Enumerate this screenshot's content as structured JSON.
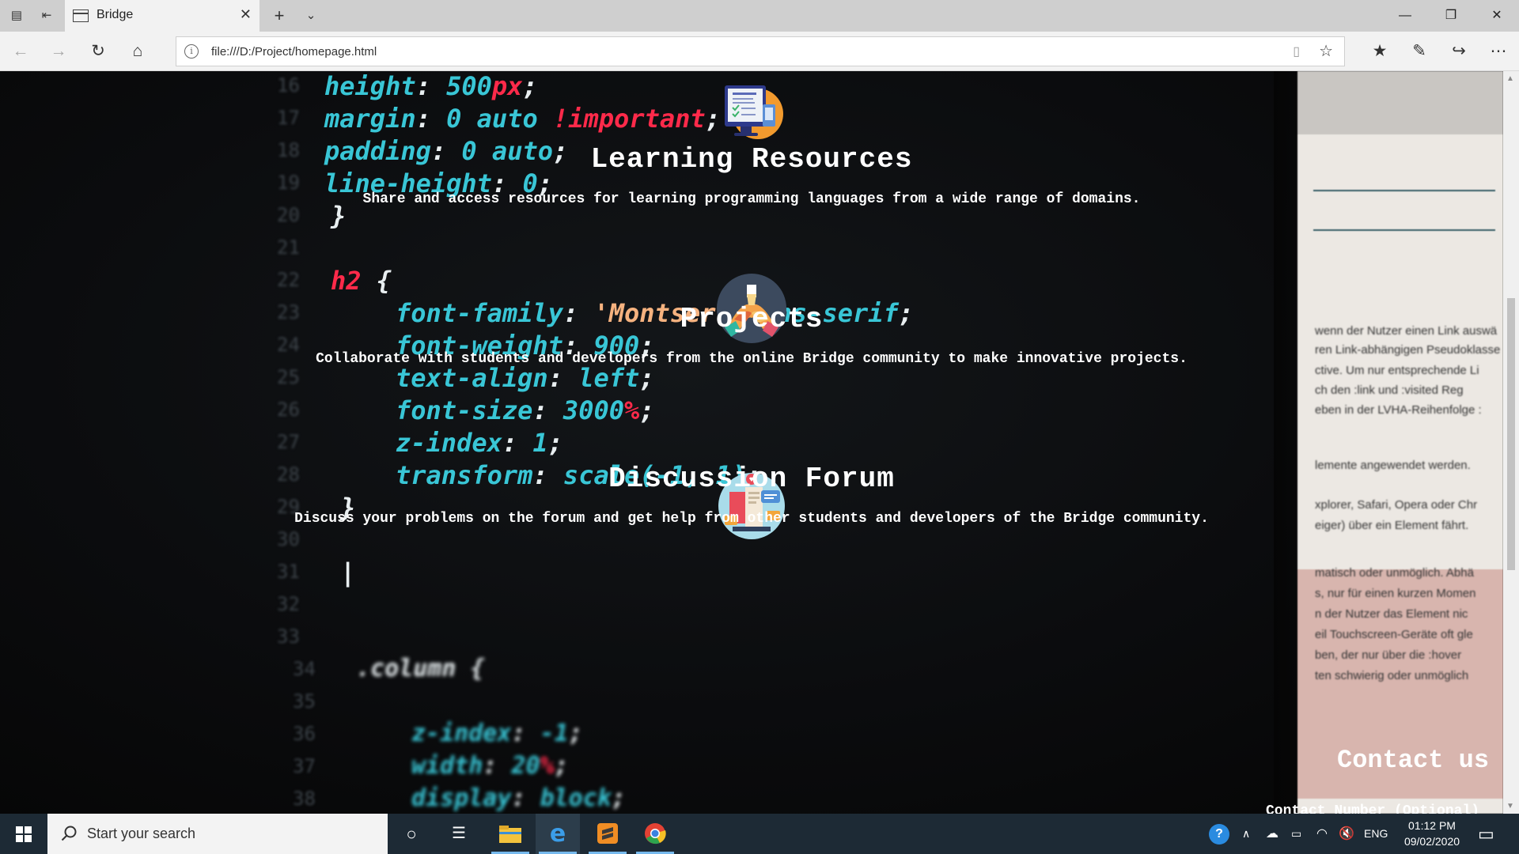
{
  "browser": {
    "tab_title": "Bridge",
    "address": "file:///D:/Project/homepage.html"
  },
  "background_code": [
    {
      "num": "16",
      "parts": [
        [
          "height",
          "cy"
        ],
        [
          ": ",
          "cw"
        ],
        [
          "500",
          "cy"
        ],
        [
          "px",
          "cr"
        ],
        [
          ";",
          "cw"
        ]
      ]
    },
    {
      "num": "17",
      "parts": [
        [
          "margin",
          "cy"
        ],
        [
          ": ",
          "cw"
        ],
        [
          "0 auto ",
          "cy"
        ],
        [
          "!important",
          "cr"
        ],
        [
          ";",
          "cw"
        ]
      ]
    },
    {
      "num": "18",
      "parts": [
        [
          "padding",
          "cy"
        ],
        [
          ": ",
          "cw"
        ],
        [
          "0 auto",
          "cy"
        ],
        [
          ";",
          "cw"
        ]
      ]
    },
    {
      "num": "19",
      "parts": [
        [
          "line-height",
          "cy"
        ],
        [
          ": ",
          "cw"
        ],
        [
          "0",
          "cy"
        ],
        [
          ";",
          "cw"
        ]
      ]
    },
    {
      "num": "20",
      "parts": [
        [
          "}",
          "cw"
        ]
      ]
    },
    {
      "num": "21",
      "parts": []
    },
    {
      "num": "22",
      "parts": [
        [
          "h2",
          "cr"
        ],
        [
          " {",
          "cw"
        ]
      ]
    },
    {
      "num": "23",
      "parts": [
        [
          "font-family",
          "cy"
        ],
        [
          ": ",
          "cw"
        ],
        [
          "'Montserr",
          "co"
        ],
        [
          " sans-serif",
          "cy"
        ],
        [
          ";",
          "cw"
        ]
      ]
    },
    {
      "num": "24",
      "parts": [
        [
          "font-weight",
          "cy"
        ],
        [
          ": ",
          "cw"
        ],
        [
          "900",
          "cy"
        ],
        [
          ";",
          "cw"
        ]
      ]
    },
    {
      "num": "25",
      "parts": [
        [
          "text-align",
          "cy"
        ],
        [
          ": ",
          "cw"
        ],
        [
          "left",
          "cy"
        ],
        [
          ";",
          "cw"
        ]
      ]
    },
    {
      "num": "26",
      "parts": [
        [
          "font-size",
          "cy"
        ],
        [
          ": ",
          "cw"
        ],
        [
          "3000",
          "cy"
        ],
        [
          "%",
          "cr"
        ],
        [
          ";",
          "cw"
        ]
      ]
    },
    {
      "num": "27",
      "parts": [
        [
          "z-index",
          "cy"
        ],
        [
          ": ",
          "cw"
        ],
        [
          "1",
          "cy"
        ],
        [
          ";",
          "cw"
        ]
      ]
    },
    {
      "num": "28",
      "parts": [
        [
          "transform",
          "cy"
        ],
        [
          ": ",
          "cw"
        ],
        [
          "scale(-1, 1)",
          "cy"
        ],
        [
          ";",
          "cw"
        ]
      ]
    },
    {
      "num": "29",
      "parts": [
        [
          "}",
          "cw"
        ]
      ]
    },
    {
      "num": "30",
      "parts": []
    },
    {
      "num": "31",
      "parts": [
        [
          "|",
          "cw"
        ]
      ]
    },
    {
      "num": "32",
      "parts": []
    },
    {
      "num": "33",
      "parts": []
    },
    {
      "num": "34",
      "parts": [
        [
          ".column {",
          "cw"
        ]
      ]
    },
    {
      "num": "35",
      "parts": []
    },
    {
      "num": "36",
      "parts": [
        [
          "z-index",
          "cy"
        ],
        [
          ": ",
          "cw"
        ],
        [
          "-1",
          "cy"
        ],
        [
          ";",
          "cw"
        ]
      ]
    },
    {
      "num": "37",
      "parts": [
        [
          "width",
          "cy"
        ],
        [
          ": ",
          "cw"
        ],
        [
          "20",
          "cy"
        ],
        [
          "%",
          "cr"
        ],
        [
          ";",
          "cw"
        ]
      ]
    },
    {
      "num": "38",
      "parts": [
        [
          "display",
          "cy"
        ],
        [
          ": ",
          "cw"
        ],
        [
          "block",
          "cy"
        ],
        [
          ";",
          "cw"
        ]
      ]
    }
  ],
  "background_doc_lines": [
    "wenn der Nutzer einen Link auswä",
    "ren Link-abhängigen Pseudoklasse",
    "ctive. Um nur entsprechende Li",
    "ch den :link und :visited Reg",
    "eben in der LVHA-Reihenfolge :",
    "lemente angewendet werden.",
    "xplorer, Safari, Opera oder Chr",
    "eiger) über ein Element fährt.",
    "matisch oder unmöglich. Abhä",
    "s, nur für einen kurzen Momen",
    "n der Nutzer das Element nic",
    "eil Touchscreen-Geräte oft gle",
    "ben, der nur über die :hover",
    "ten schwierig oder unmöglich"
  ],
  "features": [
    {
      "title": "Learning Resources",
      "description": "Share and access resources for learning programming languages from a wide range of domains.",
      "icon": "learning-resources-icon"
    },
    {
      "title": "Projects",
      "description": "Collaborate with students and developers from the online Bridge community to make innovative projects.",
      "icon": "projects-icon"
    },
    {
      "title": "Discussion Forum",
      "description": "Discuss your problems on the forum and get help from other students and developers of the Bridge community.",
      "icon": "discussion-forum-icon"
    }
  ],
  "contact": {
    "heading": "Contact us",
    "field_label": "Contact Number (Optional)"
  },
  "taskbar": {
    "search_placeholder": "Start your search",
    "language": "ENG",
    "time": "01:12 PM",
    "date": "09/02/2020"
  }
}
